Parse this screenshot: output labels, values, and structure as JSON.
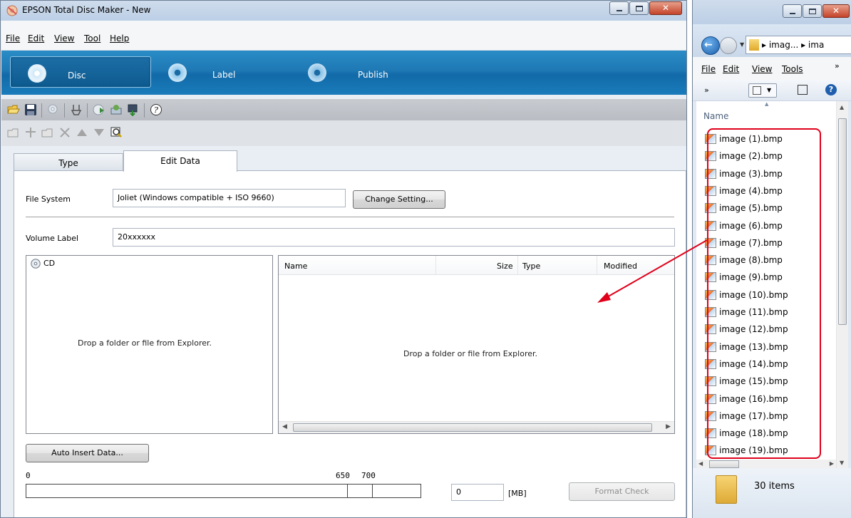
{
  "main_window": {
    "title": "EPSON Total Disc Maker - New",
    "menu": [
      "File",
      "Edit",
      "View",
      "Tool",
      "Help"
    ],
    "modes": [
      {
        "label": "Disc",
        "active": true
      },
      {
        "label": "Label",
        "active": false
      },
      {
        "label": "Publish",
        "active": false
      }
    ],
    "tabs": {
      "type": "Type",
      "edit_data": "Edit Data"
    },
    "file_system": {
      "label": "File System",
      "value": "Joliet (Windows compatible + ISO 9660)",
      "change_button": "Change Setting..."
    },
    "volume_label": {
      "label": "Volume Label",
      "value": "20xxxxxx"
    },
    "tree": {
      "root": "CD",
      "drop_hint": "Drop a folder or file from Explorer."
    },
    "file_list": {
      "columns": [
        "Name",
        "Size",
        "Type",
        "Modified"
      ],
      "drop_hint": "Drop a folder or file from Explorer."
    },
    "auto_insert_button": "Auto Insert Data...",
    "capacity": {
      "scale_start": "0",
      "mark_650": "650",
      "mark_700": "700",
      "used": "0",
      "unit": "[MB]"
    },
    "format_check_button": "Format Check"
  },
  "explorer": {
    "path": "▸ imag... ▸ ima",
    "menu": [
      "File",
      "Edit",
      "View",
      "Tools"
    ],
    "column_name": "Name",
    "files": [
      "image (1).bmp",
      "image (2).bmp",
      "image (3).bmp",
      "image (4).bmp",
      "image (5).bmp",
      "image (6).bmp",
      "image (7).bmp",
      "image (8).bmp",
      "image (9).bmp",
      "image (10).bmp",
      "image (11).bmp",
      "image (12).bmp",
      "image (13).bmp",
      "image (14).bmp",
      "image (15).bmp",
      "image (16).bmp",
      "image (17).bmp",
      "image (18).bmp",
      "image (19).bmp"
    ],
    "status": "30 items"
  },
  "colors": {
    "accent_blue": "#1e78b4",
    "highlight_red": "#e0001b"
  }
}
